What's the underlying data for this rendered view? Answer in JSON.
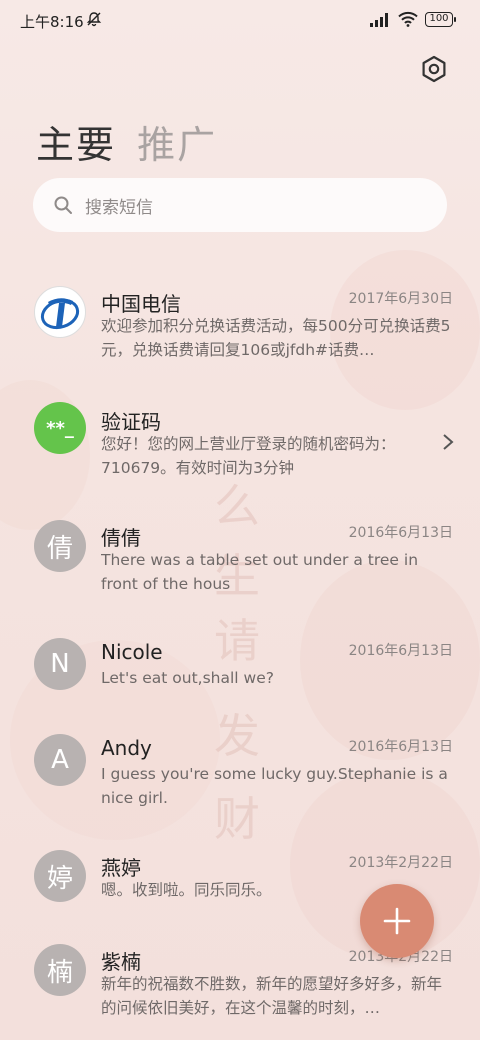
{
  "status_bar": {
    "time": "上午8:16",
    "battery": "100"
  },
  "tabs": [
    {
      "label": "主要",
      "active": true
    },
    {
      "label": "推广",
      "active": false
    }
  ],
  "search": {
    "placeholder": "搜索短信"
  },
  "watermark": [
    "么",
    "生",
    "请",
    "发",
    "财"
  ],
  "conversations": [
    {
      "avatar_type": "telecom-logo",
      "name": "中国电信",
      "date": "2017年6月30日",
      "preview": "欢迎参加积分兑换话费活动，每500分可兑换话费5元，兑换话费请回复106或jfdh#话费…"
    },
    {
      "avatar_type": "code",
      "avatar_text": "**_",
      "name": "验证码",
      "date": "",
      "preview": "您好！您的网上营业厅登录的随机密码为：710679。有效时间为3分钟",
      "has_chevron": true
    },
    {
      "avatar_type": "letter",
      "avatar_text": "倩",
      "name": "倩倩",
      "date": "2016年6月13日",
      "preview": "There was a table set out under a tree in front of the hous"
    },
    {
      "avatar_type": "letter",
      "avatar_text": "N",
      "name": "Nicole",
      "date": "2016年6月13日",
      "preview": "Let's eat out,shall we?"
    },
    {
      "avatar_type": "letter",
      "avatar_text": "A",
      "name": "Andy",
      "date": "2016年6月13日",
      "preview": "I guess you're some lucky guy.Stephanie is a nice girl."
    },
    {
      "avatar_type": "letter",
      "avatar_text": "婷",
      "name": "燕婷",
      "date": "2013年2月22日",
      "preview": "嗯。收到啦。同乐同乐。"
    },
    {
      "avatar_type": "letter",
      "avatar_text": "楠",
      "name": "紫楠",
      "date": "2013年2月22日",
      "preview": "新年的祝福数不胜数，新年的愿望好多好多，新年的问候依旧美好，在这个温馨的时刻，…"
    }
  ],
  "colors": {
    "fab": "#d98a73",
    "avatar_gray": "#b8b2b1",
    "code_green": "#64c44b",
    "telecom_blue": "#1d63b8"
  }
}
